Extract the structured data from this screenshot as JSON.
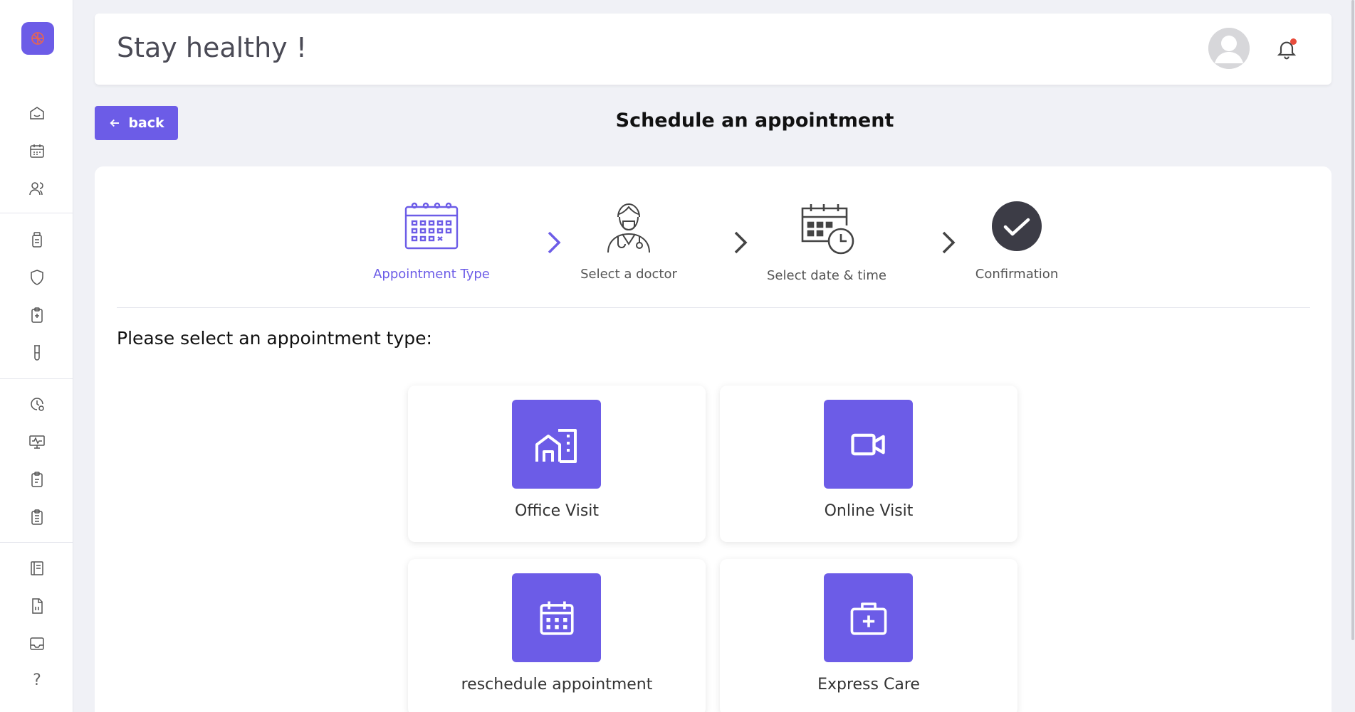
{
  "header": {
    "title": "Stay healthy !"
  },
  "sidebar": {
    "icons": [
      "home-icon",
      "calendar-icon",
      "users-icon",
      "medication-icon",
      "shield-icon",
      "clipboard-plus-icon",
      "test-tube-icon",
      "clock-history-icon",
      "monitor-vitals-icon",
      "clipboard-icon",
      "clipboard-list-icon",
      "notebook-icon",
      "document-icon",
      "inbox-icon"
    ],
    "help_label": "?"
  },
  "back_button": {
    "label": "back"
  },
  "page_title": "Schedule an appointment",
  "steps": [
    {
      "label": "Appointment Type",
      "state": "active"
    },
    {
      "label": "Select a doctor",
      "state": "pending"
    },
    {
      "label": "Select date & time",
      "state": "pending"
    },
    {
      "label": "Confirmation",
      "state": "pending"
    }
  ],
  "prompt": "Please select an appointment type:",
  "appointment_types": [
    {
      "label": "Office Visit",
      "icon": "office-building-icon"
    },
    {
      "label": "Online Visit",
      "icon": "video-camera-icon"
    },
    {
      "label": "reschedule appointment",
      "icon": "calendar-icon"
    },
    {
      "label": "Express Care",
      "icon": "medical-kit-icon"
    }
  ],
  "colors": {
    "accent": "#6c5ce7",
    "background": "#f0f1f6",
    "card": "#ffffff",
    "notification_dot": "#e74c3c"
  }
}
